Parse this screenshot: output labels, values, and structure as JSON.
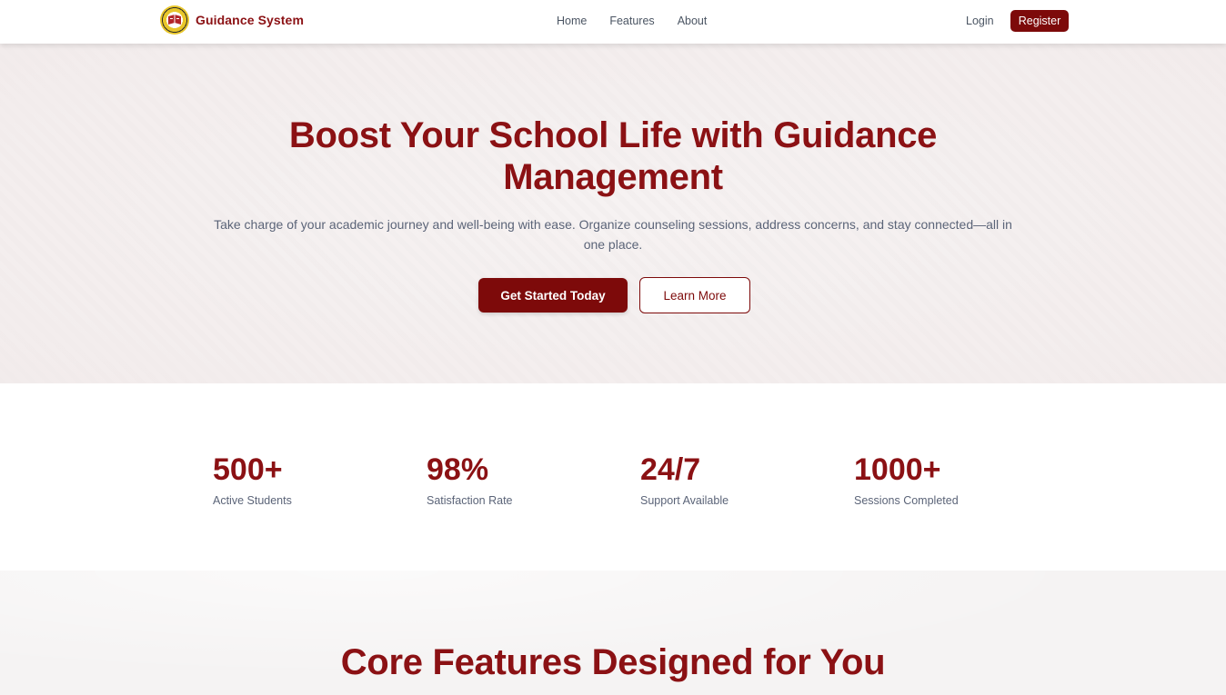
{
  "brand": {
    "name": "Guidance System",
    "logo": "school-seal-logo"
  },
  "nav": {
    "links": [
      "Home",
      "Features",
      "About"
    ],
    "login": "Login",
    "register": "Register"
  },
  "hero": {
    "title_line1": "Boost Your School Life with Guidance",
    "title_line2": "Management",
    "subtitle": "Take charge of your academic journey and well-being with ease. Organize counseling sessions, address concerns, and stay connected—all in one place.",
    "primary_cta": "Get Started Today",
    "secondary_cta": "Learn More"
  },
  "stats": [
    {
      "value": "500+",
      "label": "Active Students"
    },
    {
      "value": "98%",
      "label": "Satisfaction Rate"
    },
    {
      "value": "24/7",
      "label": "Support Available"
    },
    {
      "value": "1000+",
      "label": "Sessions Completed"
    }
  ],
  "features": {
    "title": "Core Features Designed for You"
  },
  "colors": {
    "brand": "#8b1114",
    "button": "#7d0a0a",
    "muted_text": "#5b6478"
  }
}
